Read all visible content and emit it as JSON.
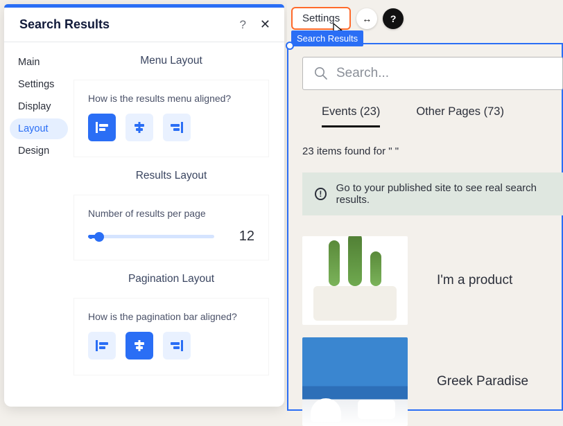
{
  "panel": {
    "title": "Search Results",
    "tabs": {
      "main": "Main",
      "settings": "Settings",
      "display": "Display",
      "layout": "Layout",
      "design": "Design"
    },
    "menuLayout": {
      "title": "Menu Layout",
      "question": "How is the results menu aligned?"
    },
    "resultsLayout": {
      "title": "Results Layout",
      "label": "Number of results per page",
      "value": "12"
    },
    "paginationLayout": {
      "title": "Pagination Layout",
      "question": "How is the pagination bar aligned?"
    }
  },
  "toolbar": {
    "settingsButton": "Settings",
    "elementLabel": "Search Results"
  },
  "preview": {
    "searchPlaceholder": "Search...",
    "tabEvents": "Events (23)",
    "tabOther": "Other Pages (73)",
    "itemsFound": "23 items found for \" \"",
    "notice": "Go to your published site to see real search results.",
    "results": {
      "r0": "I'm a product",
      "r1": "Greek Paradise"
    }
  }
}
